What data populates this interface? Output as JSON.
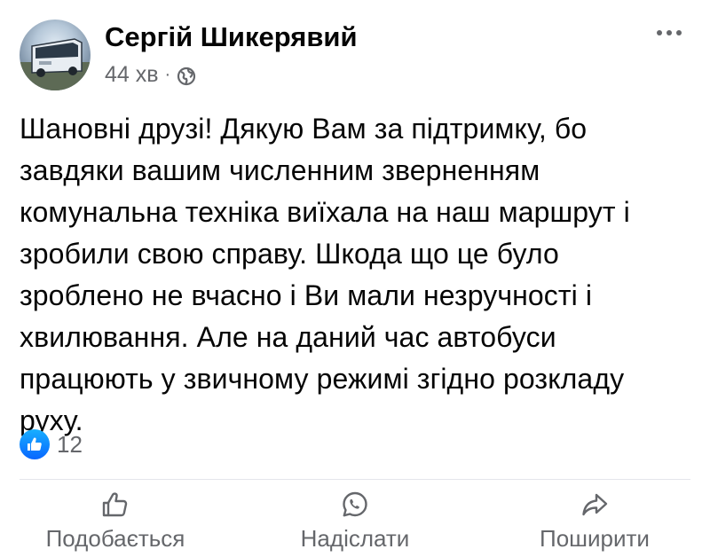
{
  "post": {
    "author": "Сергій Шикерявий",
    "time": "44 хв",
    "separator": "·",
    "privacy_icon": "globe-icon",
    "text_lines": [
      "Шановні друзі! Дякую Вам за підтримку, бо",
      "завдяки вашим численним зверненням",
      "комунальна техніка виїхала на наш маршрут і",
      "зробили свою справу. Шкода що це було",
      "зроблено не вчасно і Ви мали незручності і",
      "хвилювання. Але на даний час автобуси",
      "працюють у звичному режимі згідно розкладу",
      "руху."
    ],
    "reactions": {
      "icon": "like-reaction-icon",
      "count": "12"
    }
  },
  "actions": {
    "like": {
      "label": "Подобається",
      "icon": "thumbs-up-icon"
    },
    "send": {
      "label": "Надіслати",
      "icon": "whatsapp-icon"
    },
    "share": {
      "label": "Поширити",
      "icon": "share-arrow-icon"
    }
  },
  "colors": {
    "text": "#050505",
    "secondary": "#65676b",
    "like_blue": "#0866ff",
    "divider": "#e4e6eb"
  }
}
